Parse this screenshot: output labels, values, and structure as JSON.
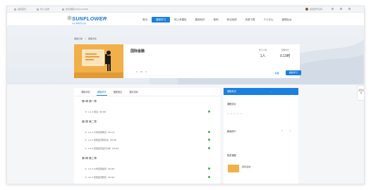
{
  "topbar": {
    "left_links": [
      "返回首页",
      "登入/注册"
    ],
    "search_placeholder": "搜索课程/SUNFLOWER",
    "user_name": "游客账号名称"
  },
  "logo": {
    "name": "SUNFLOWER",
    "sub": "向日葵教育在线"
  },
  "nav": {
    "items": [
      {
        "label": "首页",
        "active": false
      },
      {
        "label": "课程学习",
        "active": true
      },
      {
        "label": "网上考模拟",
        "active": false
      },
      {
        "label": "题库知识",
        "active": false
      },
      {
        "label": "案例",
        "active": false
      },
      {
        "label": "考试成绩",
        "active": false
      },
      {
        "label": "资源下载",
        "active": false
      },
      {
        "label": "个人中心",
        "active": false
      },
      {
        "label": "管理后台",
        "active": false
      }
    ]
  },
  "breadcrumb": {
    "home": "课程分类",
    "sep": ">",
    "current": "课程详情"
  },
  "course": {
    "title": "国际金融",
    "learners_label": "学习人数",
    "learners_value": "1人",
    "duration_label": "课程时长",
    "duration_value": "0.19时",
    "favorite_label": "收藏",
    "join_label": "继续学习"
  },
  "tabs": [
    {
      "label": "课程详情",
      "active": false
    },
    {
      "label": "课程章节",
      "active": true
    },
    {
      "label": "课程笔记",
      "active": false
    },
    {
      "label": "课件资料",
      "active": false
    }
  ],
  "chapters": [
    {
      "title": "第1章 第一章",
      "sections": [
        "1-1-1 测试（01:00）"
      ]
    },
    {
      "title": "第2章 第二章",
      "sections": [
        "2-1-2 大学宏观概况（01:14）",
        "2-2-2 宏观经济研究法（01:00）",
        "2-3-2 宏观经济运行分析（01:00）"
      ]
    },
    {
      "title": "第3章 第三章",
      "sections": [
        "3-1-3 大学宏观经济（01:00）",
        "3-2-3 宏观经济研究（01:00）"
      ]
    }
  ],
  "right": {
    "head": "课程考试",
    "rating_label": "课程评价",
    "teacher_label": "教师简介",
    "related_label": "相关课程",
    "related_title": "国际金融"
  },
  "float_panel": {
    "label": "返回顶部"
  },
  "colors": {
    "accent": "#1a7fe0",
    "complete": "#36b24a",
    "thumb": "#f2b04a"
  }
}
